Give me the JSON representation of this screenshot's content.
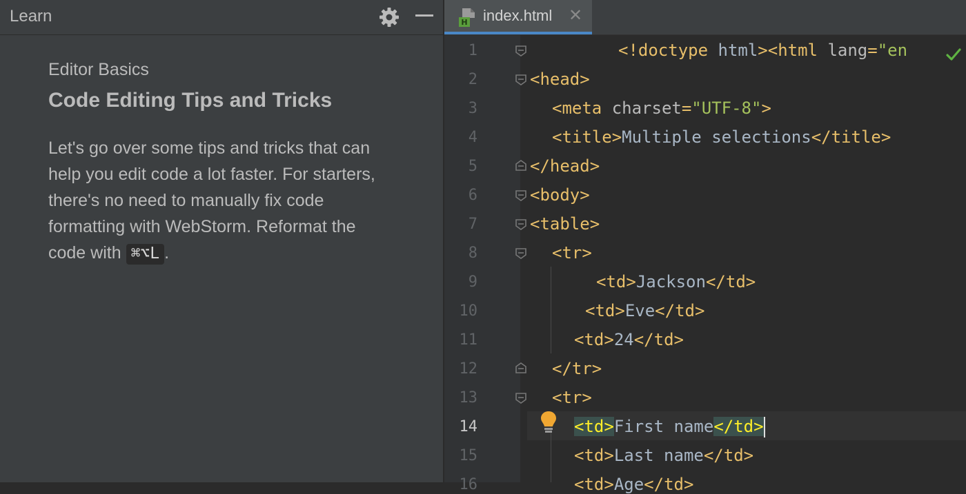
{
  "learn_panel": {
    "title": "Learn",
    "module": "Editor Basics",
    "lesson": "Code Editing Tips and Tricks",
    "text": "Let's go over some tips and tricks that can help you edit code a lot faster. For starters, there's no need to manually fix code formatting with WebStorm. Reformat the code with ",
    "shortcut": "⌘⌥L",
    "text_end": "."
  },
  "tab": {
    "label": "index.html",
    "close": "✕"
  },
  "editor": {
    "current_line": 14,
    "line_numbers": [
      "1",
      "2",
      "3",
      "4",
      "5",
      "6",
      "7",
      "8",
      "9",
      "10",
      "11",
      "12",
      "13",
      "14",
      "15",
      "16"
    ],
    "colors": {
      "tag": "#e8bf6a",
      "attribute": "#bababa",
      "attribute_value": "#a5c25c",
      "text": "#a9b7c6",
      "background": "#2b2b2b",
      "gutter": "#313335"
    },
    "lines": [
      "<!doctype html><html lang=\"en",
      "<head>",
      "<meta charset=\"UTF-8\">",
      "<title>Multiple selections</title>",
      "</head>",
      "<body>",
      "<table>",
      "<tr>",
      "<td>Jackson</td>",
      "<td>Eve</td>",
      "<td>24</td>",
      "</tr>",
      "<tr>",
      "<td>First name</td>",
      "<td>Last name</td>",
      "<td>Age</td>"
    ]
  },
  "icons": {
    "settings": "gear-icon",
    "minimize": "minimize-icon",
    "file": "html-file-icon",
    "inspection": "check-icon",
    "intention": "lightbulb-icon"
  }
}
